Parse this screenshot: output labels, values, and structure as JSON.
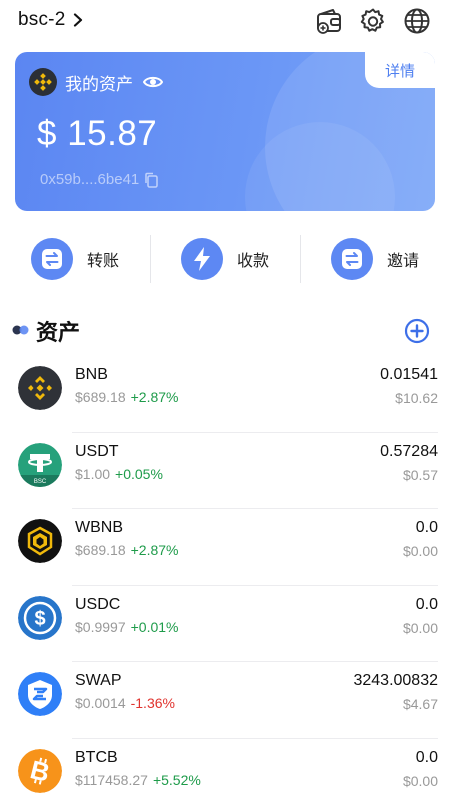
{
  "header": {
    "network": "bsc-2"
  },
  "card": {
    "title": "我的资产",
    "detail_label": "详情",
    "balance": "$ 15.87",
    "address": "0x59b....6be41"
  },
  "actions": [
    {
      "label": "转账"
    },
    {
      "label": "收款"
    },
    {
      "label": "邀请"
    }
  ],
  "assets_section": {
    "title": "资产"
  },
  "tokens": [
    {
      "symbol": "BNB",
      "price": "$689.18",
      "change": "+2.87%",
      "amount": "0.01541",
      "value": "$10.62",
      "icon": "bnb-icon"
    },
    {
      "symbol": "USDT",
      "price": "$1.00",
      "change": "+0.05%",
      "amount": "0.57284",
      "value": "$0.57",
      "icon": "usdt-icon"
    },
    {
      "symbol": "WBNB",
      "price": "$689.18",
      "change": "+2.87%",
      "amount": "0.0",
      "value": "$0.00",
      "icon": "wbnb-icon"
    },
    {
      "symbol": "USDC",
      "price": "$0.9997",
      "change": "+0.01%",
      "amount": "0.0",
      "value": "$0.00",
      "icon": "usdc-icon"
    },
    {
      "symbol": "SWAP",
      "price": "$0.0014",
      "change": "-1.36%",
      "amount": "3243.00832",
      "value": "$4.67",
      "icon": "swap-icon"
    },
    {
      "symbol": "BTCB",
      "price": "$117458.27",
      "change": "+5.52%",
      "amount": "0.0",
      "value": "$0.00",
      "icon": "btcb-icon"
    }
  ],
  "usdt_badge": "BSC",
  "colors": {
    "accent": "#5d88f3",
    "card_gradient_start": "#5b86f2",
    "positive": "#1e9b4a",
    "negative": "#e0332e"
  }
}
